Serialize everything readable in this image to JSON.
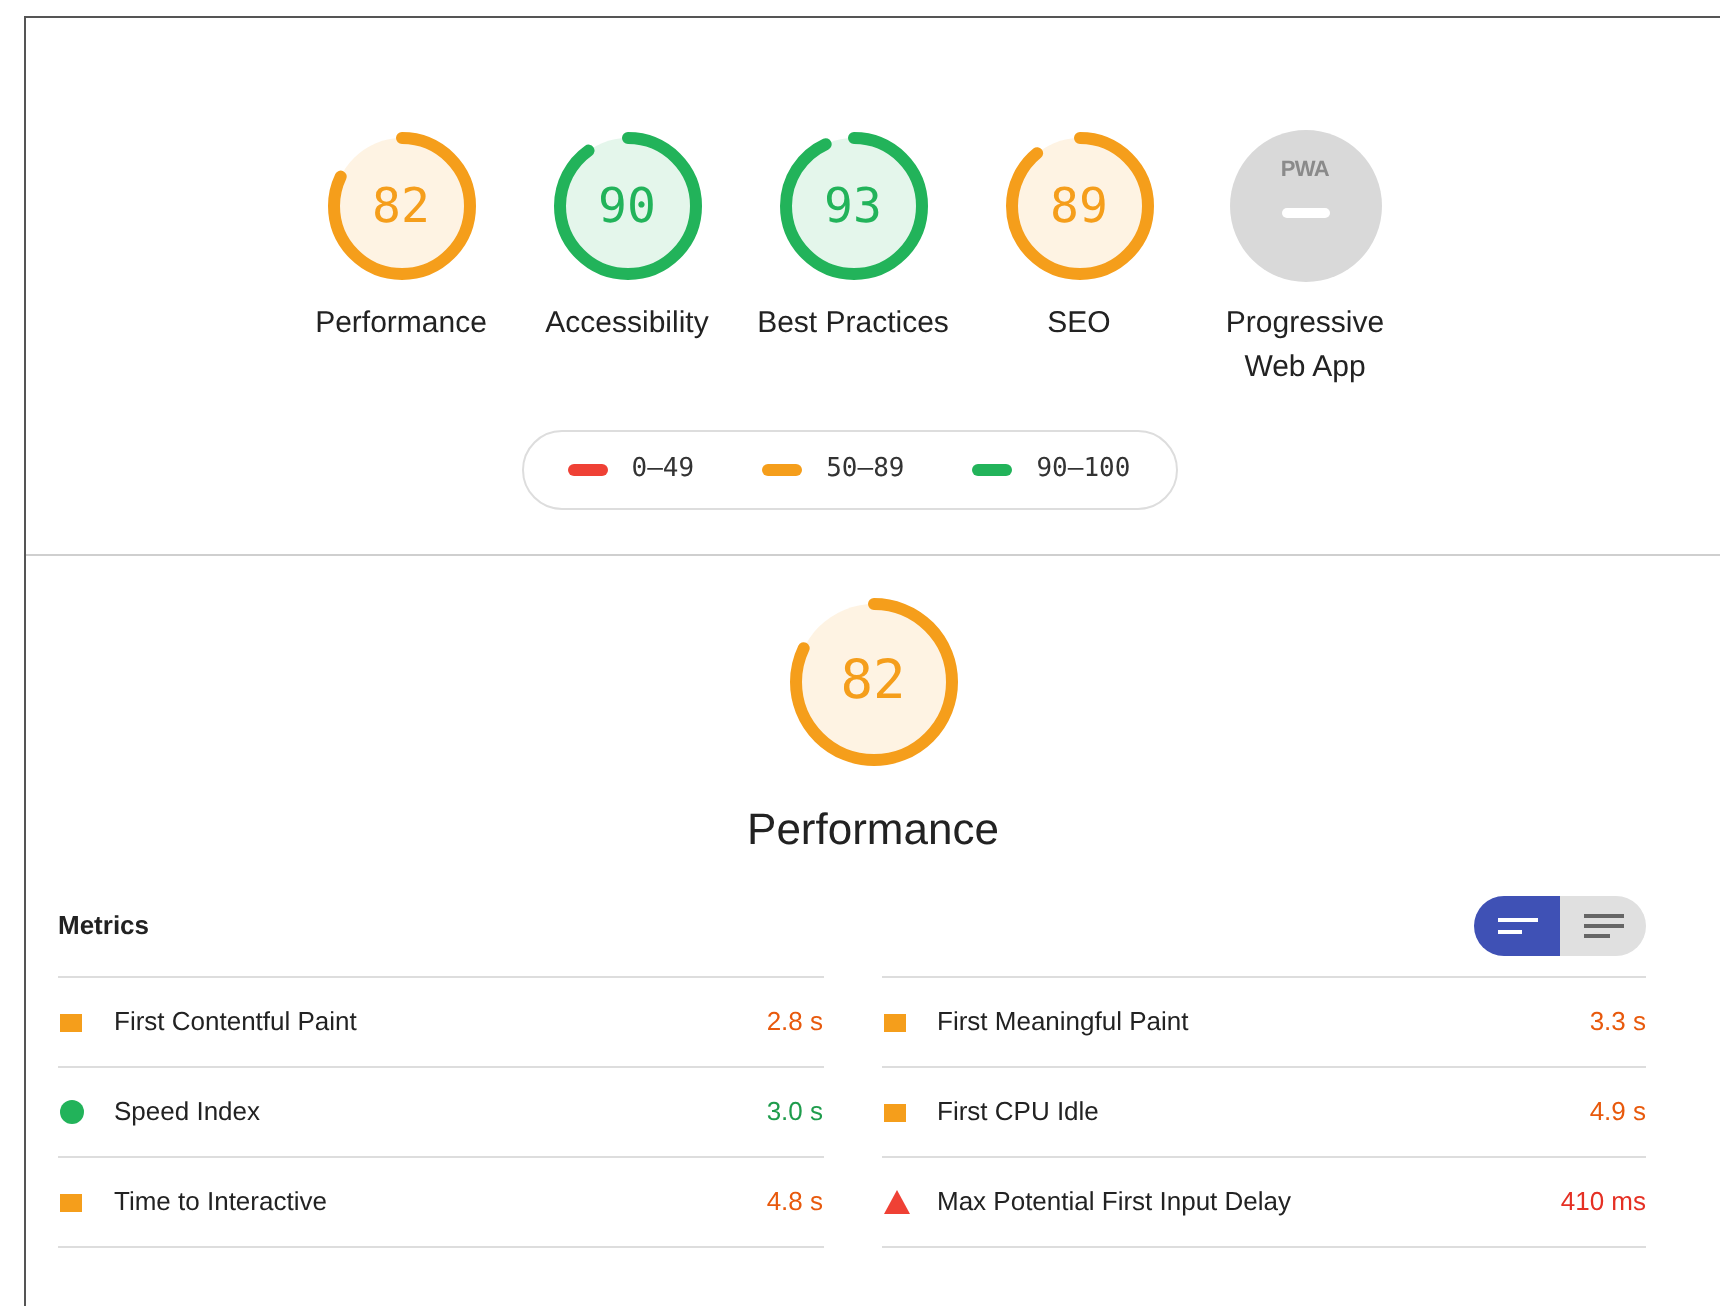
{
  "categories": [
    {
      "kind": "score",
      "score": "82",
      "color": "#f59e1b",
      "label": "Performance"
    },
    {
      "kind": "score",
      "score": "90",
      "color": "#22b35a",
      "label": "Accessibility"
    },
    {
      "kind": "score",
      "score": "93",
      "color": "#22b35a",
      "label": "Best Practices"
    },
    {
      "kind": "score",
      "score": "89",
      "color": "#f59e1b",
      "label": "SEO"
    },
    {
      "kind": "pwa",
      "badge": "PWA",
      "label": "Progressive Web App"
    }
  ],
  "legend": [
    {
      "color": "#ef4135",
      "range": "0–49"
    },
    {
      "color": "#f59e1b",
      "range": "50–89"
    },
    {
      "color": "#22b35a",
      "range": "90–100"
    }
  ],
  "performance": {
    "score": "82",
    "color": "#f59e1b",
    "title": "Performance"
  },
  "metrics": {
    "title": "Metrics",
    "view_toggle": [
      {
        "selected": true
      },
      {
        "selected": false
      }
    ],
    "columns": [
      [
        {
          "kind": "average",
          "name": "First Contentful Paint",
          "value": "2.8 s"
        },
        {
          "kind": "pass",
          "name": "Speed Index",
          "value": "3.0 s"
        },
        {
          "kind": "average",
          "name": "Time to Interactive",
          "value": "4.8 s"
        }
      ],
      [
        {
          "kind": "average",
          "name": "First Meaningful Paint",
          "value": "3.3 s"
        },
        {
          "kind": "average",
          "name": "First CPU Idle",
          "value": "4.9 s"
        },
        {
          "kind": "fail",
          "name": "Max Potential First Input Delay",
          "value": "410 ms"
        }
      ]
    ]
  }
}
